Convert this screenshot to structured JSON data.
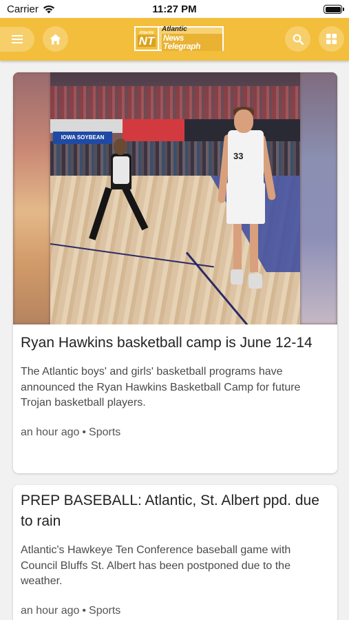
{
  "status_bar": {
    "carrier": "Carrier",
    "time": "11:27 PM"
  },
  "header": {
    "logo": {
      "badge_small": "Atlantic",
      "badge_big": "NT",
      "line1": "Atlantic",
      "line2": "News Telegraph"
    },
    "icons": [
      "menu-icon",
      "home-icon",
      "search-icon",
      "grid-icon"
    ],
    "accent_color": "#f2be3c"
  },
  "articles": [
    {
      "title": "Ryan Hawkins basketball camp is June 12-14",
      "summary": "The Atlantic boys' and girls' basketball programs have announced the Ryan Hawkins Basketball Camp for future Trojan basketball players.",
      "time": "an hour ago",
      "separator": "•",
      "category": "Sports",
      "image": {
        "ad_board": "IOWA SOYBEAN",
        "jersey_number": "33"
      }
    },
    {
      "title": "PREP BASEBALL: Atlantic, St. Albert ppd. due to rain",
      "summary": "Atlantic's Hawkeye Ten Conference baseball game with Council Bluffs St. Albert has been postponed due to the weather.",
      "time": "an hour ago",
      "separator": "•",
      "category": "Sports"
    }
  ]
}
